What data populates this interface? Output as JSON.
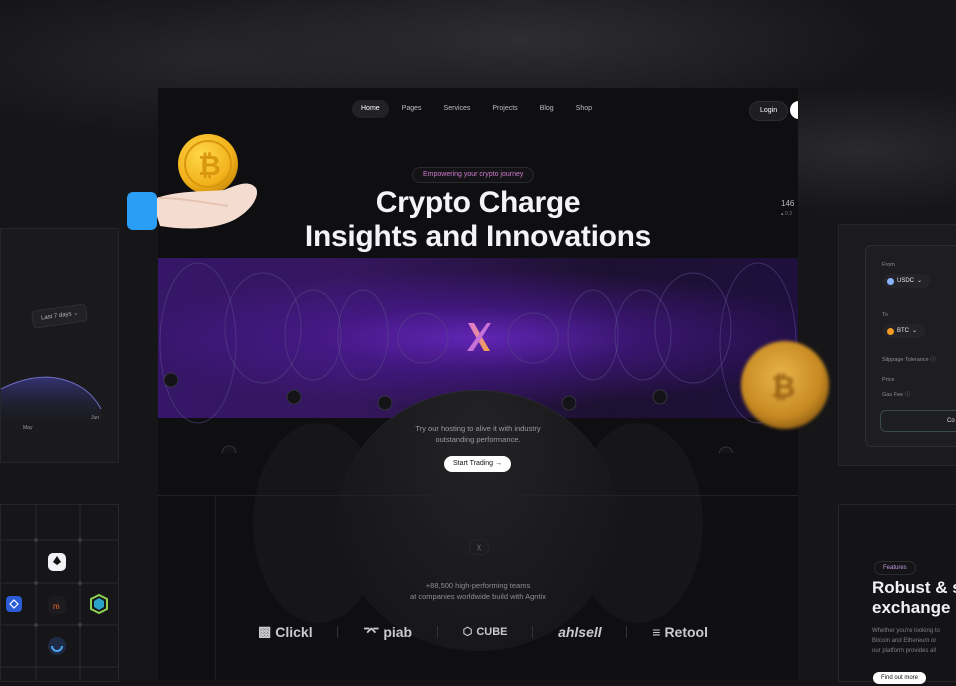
{
  "nav": {
    "items": [
      "Home",
      "Pages",
      "Services",
      "Projects",
      "Blog",
      "Shop"
    ],
    "active": "Home",
    "login_label": "Login"
  },
  "hero": {
    "badge": "Empowering your crypto journey",
    "headline_line1": "Crypto Charge",
    "headline_line2": "Insights and Innovations",
    "subcopy_line1": "Try our hosting to alive it with industry",
    "subcopy_line2": "outstanding performance.",
    "cta_label": "Start Trading",
    "cta_icon": "arrow-right-icon"
  },
  "stat_peek": {
    "value": "146",
    "note": "▴ 0.3"
  },
  "social_proof": {
    "line1": "+88,500 high-performing teams",
    "line2": "at companies worldwide build with Agntix",
    "logos": [
      "Clickl",
      "piab",
      "CUBE",
      "ahlsell",
      "Retool"
    ]
  },
  "left_chart": {
    "dropdown": "Last 7 days",
    "x_labels": [
      "May",
      "Jun"
    ]
  },
  "swap_card": {
    "from_label": "From",
    "from_token": "USDC",
    "to_label": "To",
    "to_token": "BTC",
    "slippage_label": "Slippage Tolerance",
    "price_label": "Price",
    "gas_label": "Gas Fee",
    "button_label": "Co"
  },
  "features_card": {
    "badge": "Features",
    "title_line1": "Robust & s",
    "title_line2": "exchange",
    "copy_line1": "Whether you're looking to",
    "copy_line2": "Bitcoin and Ethereum or",
    "copy_line3": "our platform provides all",
    "button_label": "Find out more"
  },
  "colors": {
    "background": "#0f0f11",
    "accent_purple": "#6a28c8",
    "badge_pink": "#d07bd2",
    "coin_gold": "#f2b21b"
  }
}
